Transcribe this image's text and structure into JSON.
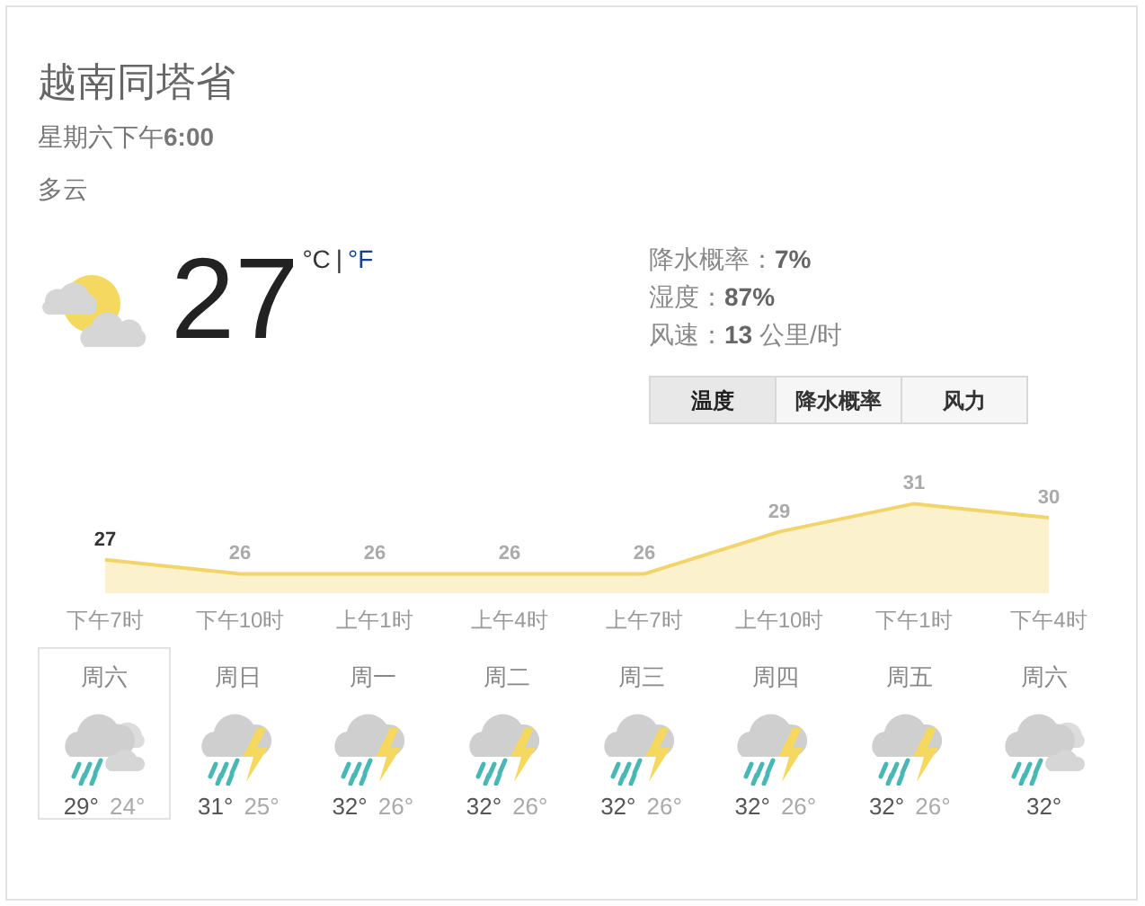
{
  "location": "越南同塔省",
  "time": {
    "day": "星期六下午",
    "clock": "6:00"
  },
  "condition": "多云",
  "current": {
    "temp": "27",
    "unit_c": "°C",
    "separator": "|",
    "unit_f": "°F"
  },
  "details": [
    {
      "label": "降水概率：",
      "value": "7%"
    },
    {
      "label": "湿度：",
      "value": "87%"
    },
    {
      "label": "风速：",
      "value": "13",
      "unit": "公里/时"
    }
  ],
  "tabs": [
    {
      "label": "温度",
      "selected": true
    },
    {
      "label": "降水概率",
      "selected": false
    },
    {
      "label": "风力",
      "selected": false
    }
  ],
  "chart_data": {
    "type": "area",
    "categories": [
      "下午7时",
      "下午10时",
      "上午1时",
      "上午4时",
      "上午7时",
      "上午10时",
      "下午1时",
      "下午4时"
    ],
    "series": [
      {
        "color": "#f2d46b",
        "values": [
          27,
          26,
          26,
          26,
          26,
          29,
          31,
          30
        ]
      }
    ],
    "data_labels": true
  },
  "days": [
    {
      "day": "周六",
      "kind": "showers-cloudy",
      "high": "29°",
      "low": "24°",
      "selected": true
    },
    {
      "day": "周日",
      "kind": "thunderstorm",
      "high": "31°",
      "low": "25°",
      "selected": false
    },
    {
      "day": "周一",
      "kind": "thunderstorm",
      "high": "32°",
      "low": "26°",
      "selected": false
    },
    {
      "day": "周二",
      "kind": "thunderstorm",
      "high": "32°",
      "low": "26°",
      "selected": false
    },
    {
      "day": "周三",
      "kind": "thunderstorm",
      "high": "32°",
      "low": "26°",
      "selected": false
    },
    {
      "day": "周四",
      "kind": "thunderstorm",
      "high": "32°",
      "low": "26°",
      "selected": false
    },
    {
      "day": "周五",
      "kind": "thunderstorm",
      "high": "32°",
      "low": "26°",
      "selected": false
    },
    {
      "day": "周六",
      "kind": "showers-cloudy",
      "high": "32°",
      "selected": false
    }
  ]
}
